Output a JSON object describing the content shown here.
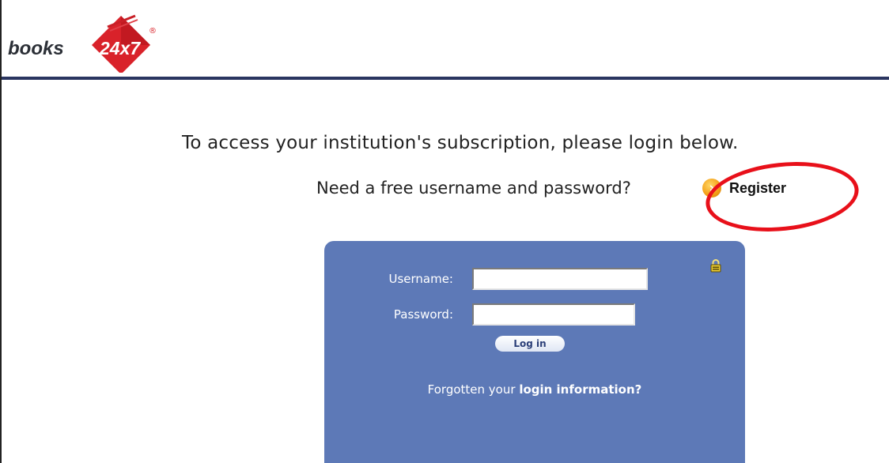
{
  "header": {
    "logo_text_books": "books",
    "logo_text_24x7": "24x7",
    "logo_registered": "®"
  },
  "main": {
    "intro_text": "To access your institution's subscription, please login below.",
    "register_prompt": "Need a free username and password?",
    "register_label": "Register",
    "register_icon": "orange-arrow-icon"
  },
  "login": {
    "username_label": "Username:",
    "username_value": "",
    "password_label": "Password:",
    "password_value": "",
    "login_button": "Log in",
    "forgot_prefix": "Forgotten your",
    "forgot_link": "login information?",
    "lock_icon": "lock-icon"
  },
  "colors": {
    "header_line": "#2a3560",
    "login_box_bg": "#5d79b7",
    "annotation_circle": "#e8101a",
    "logo_red": "#d9222a"
  }
}
